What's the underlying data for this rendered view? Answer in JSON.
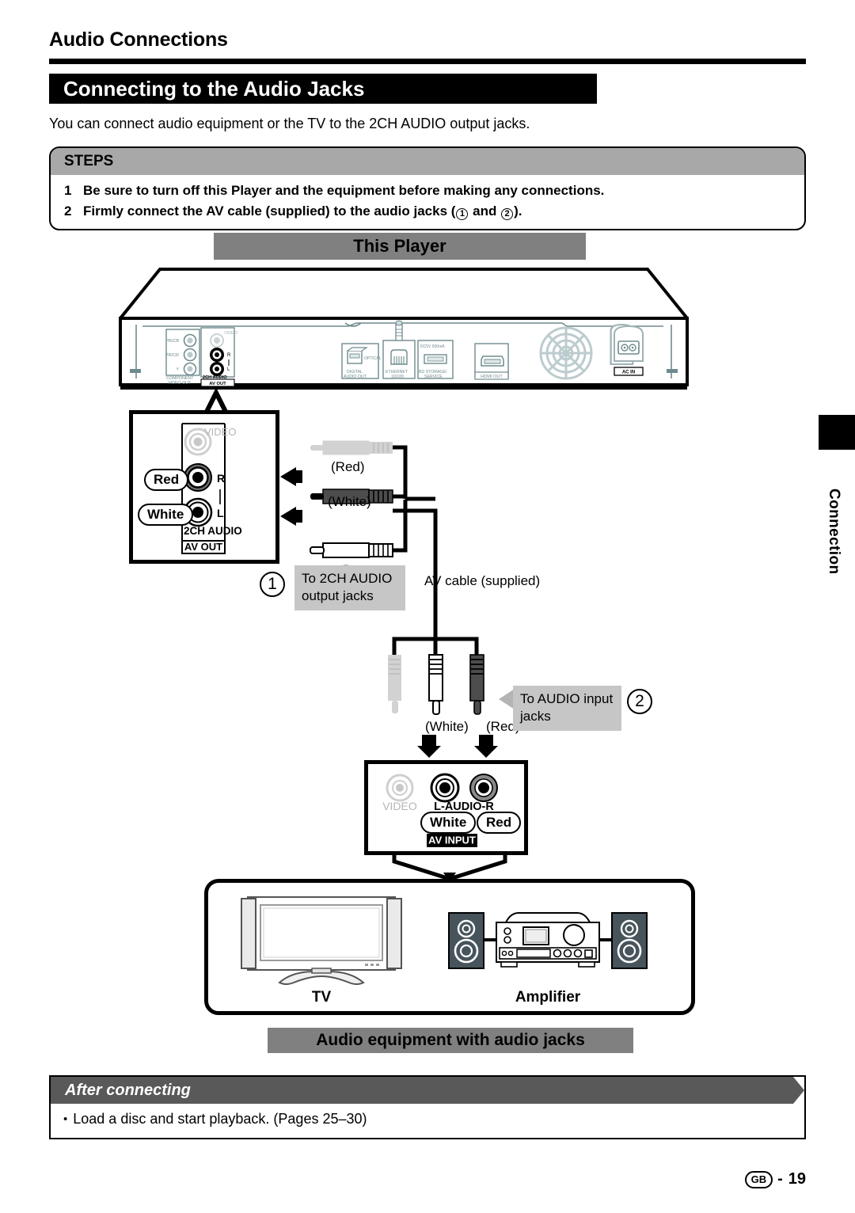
{
  "header": {
    "section_title": "Audio Connections",
    "title": "Connecting to the Audio Jacks",
    "intro": "You can connect audio equipment or the TV to the 2CH AUDIO output jacks."
  },
  "steps": {
    "heading": "STEPS",
    "items": [
      {
        "num": "1",
        "text": "Be sure to turn off this Player and the equipment before making any connections."
      },
      {
        "num": "2",
        "text_before": "Firmly connect the AV cable (supplied) to the audio jacks (",
        "circle_a": "1",
        "text_mid": " and ",
        "circle_b": "2",
        "text_after": ")."
      }
    ]
  },
  "diagram": {
    "this_player_label": "This Player",
    "audio_equipment_label": "Audio equipment with audio jacks",
    "rear_panel": {
      "component_labels": [
        "PB/CB",
        "PR/CR",
        "Y"
      ],
      "component_caption_l1": "COMPONENT",
      "component_caption_l2": "VIDEO OUT",
      "video_label": "VIDEO",
      "ch_r": "R",
      "ch_l": "L",
      "audio_caption": "2CH AUDIO",
      "av_out_caption": "AV OUT",
      "digital_audio_l1": "DIGITAL",
      "digital_audio_l2": "AUDIO OUT",
      "optical_label": "OPTICAL",
      "ethernet_l1": "ETHERNET",
      "ethernet_l2": "10/100",
      "usb_top_label": "DC5V 500mA",
      "usb_l1": "BD STORAGE/",
      "usb_l2": "SERVICE",
      "hdmi_label": "HDMI OUT",
      "ac_in_label": "AC IN"
    },
    "av_out_detail": {
      "video_label": "VIDEO",
      "red_badge": "Red",
      "white_badge": "White",
      "ch_r": "R",
      "ch_l": "L",
      "audio_caption": "2CH AUDIO",
      "av_out_caption": "AV OUT"
    },
    "cable": {
      "top_plug_labels": [
        "(Red)",
        "(White)"
      ],
      "bottom_plug_labels": [
        "(White)",
        "(Red)"
      ],
      "cable_name": "AV cable (supplied)",
      "callout_1_num": "1",
      "callout_1_l1": "To 2CH AUDIO",
      "callout_1_l2": "output jacks",
      "callout_2_num": "2",
      "callout_2_l1": "To AUDIO input",
      "callout_2_l2": "jacks"
    },
    "av_input_detail": {
      "video_label": "VIDEO",
      "audio_label": "L-AUDIO-R",
      "white_badge": "White",
      "red_badge": "Red",
      "av_input_caption": "AV INPUT"
    },
    "equipment": {
      "tv_label": "TV",
      "amplifier_label": "Amplifier"
    }
  },
  "after_connecting": {
    "heading": "After connecting",
    "bullet_char": "•",
    "text": "Load a disc and start playback. (Pages 25–30)"
  },
  "side_tab": {
    "label": "Connection"
  },
  "footer": {
    "region": "GB",
    "dash": "-",
    "page": "19"
  },
  "colors": {
    "gray_bar": "#808080",
    "steps_head": "#a8a8a8",
    "callout_bg": "#c6c6c6",
    "after_head": "#595959",
    "speaker": "#47545c",
    "panel_line": "#6f8a8e"
  }
}
